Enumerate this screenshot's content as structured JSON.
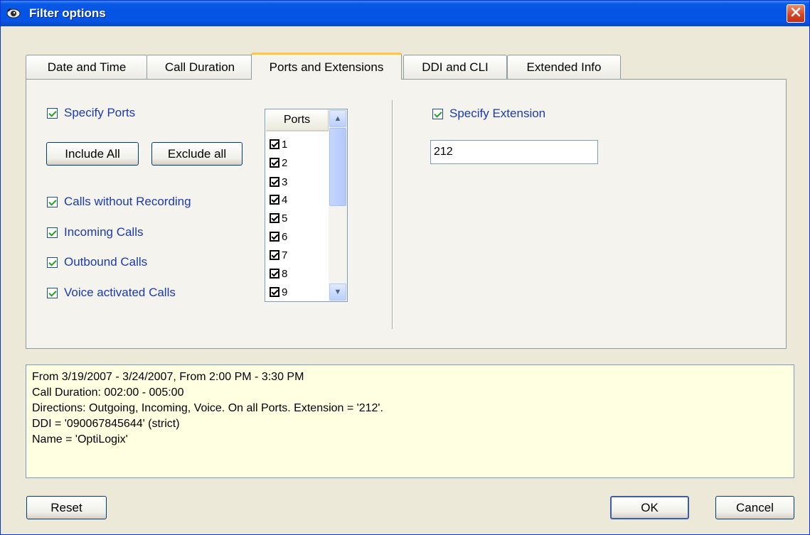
{
  "window": {
    "title": "Filter options"
  },
  "tabs": [
    {
      "label": "Date and Time"
    },
    {
      "label": "Call Duration"
    },
    {
      "label": "Ports and Extensions"
    },
    {
      "label": "DDI and CLI"
    },
    {
      "label": "Extended Info"
    }
  ],
  "active_tab": "Ports and Extensions",
  "ports_section": {
    "specify_ports_label": "Specify Ports",
    "include_all_label": "Include All",
    "exclude_all_label": "Exclude all",
    "options": [
      {
        "label": "Calls without Recording",
        "checked": true
      },
      {
        "label": "Incoming Calls",
        "checked": true
      },
      {
        "label": "Outbound Calls",
        "checked": true
      },
      {
        "label": "Voice activated Calls",
        "checked": true
      }
    ],
    "ports_list": {
      "header": "Ports",
      "items": [
        {
          "label": "1",
          "checked": true
        },
        {
          "label": "2",
          "checked": true
        },
        {
          "label": "3",
          "checked": true
        },
        {
          "label": "4",
          "checked": true
        },
        {
          "label": "5",
          "checked": true
        },
        {
          "label": "6",
          "checked": true
        },
        {
          "label": "7",
          "checked": true
        },
        {
          "label": "8",
          "checked": true
        },
        {
          "label": "9",
          "checked": true
        }
      ]
    }
  },
  "extension_section": {
    "specify_extension_label": "Specify Extension",
    "extension_value": "212"
  },
  "summary": {
    "lines": [
      "From 3/19/2007 - 3/24/2007, From 2:00 PM - 3:30 PM",
      "Call Duration: 002:00 - 005:00",
      "Directions: Outgoing, Incoming, Voice.  On all Ports.  Extension = '212'.",
      "DDI = '090067845644' (strict)",
      "Name = 'OptiLogix'"
    ]
  },
  "footer": {
    "reset_label": "Reset",
    "ok_label": "OK",
    "cancel_label": "Cancel"
  },
  "colors": {
    "titlebar": "#0554e3",
    "dialog_bg": "#ece9d8",
    "panel_bg": "#f4f3ee",
    "summary_bg": "#ffffe1",
    "label_blue": "#1b3ca8",
    "active_tab_accent": "#ffc83c",
    "close_button": "#d8401f"
  },
  "icons": {
    "title_icon": "eye-icon",
    "close": "close-icon"
  }
}
